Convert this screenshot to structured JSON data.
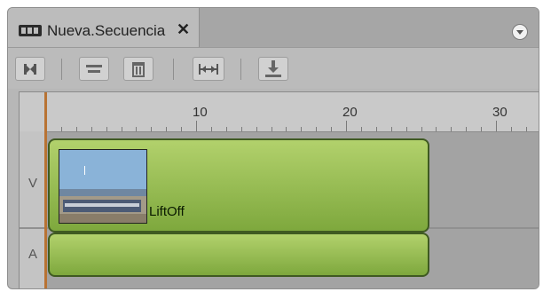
{
  "tab": {
    "title": "Nueva.Secuencia",
    "close_glyph": "✕"
  },
  "ruler": {
    "labels": [
      "10",
      "20",
      "30"
    ]
  },
  "tracks": [
    {
      "label": "V"
    },
    {
      "label": "A"
    }
  ],
  "clips": {
    "video": {
      "name": "LiftOff"
    }
  },
  "colors": {
    "clip": "#9dc05a",
    "clip_border": "#3f5a21",
    "playhead": "#b87333",
    "panel": "#b7b7b7"
  },
  "icons": [
    "sequence-icon",
    "close-icon",
    "panel-menu-icon",
    "lift-extract-icon",
    "trim-icon",
    "delete-icon",
    "fit-icon",
    "export-icon"
  ]
}
